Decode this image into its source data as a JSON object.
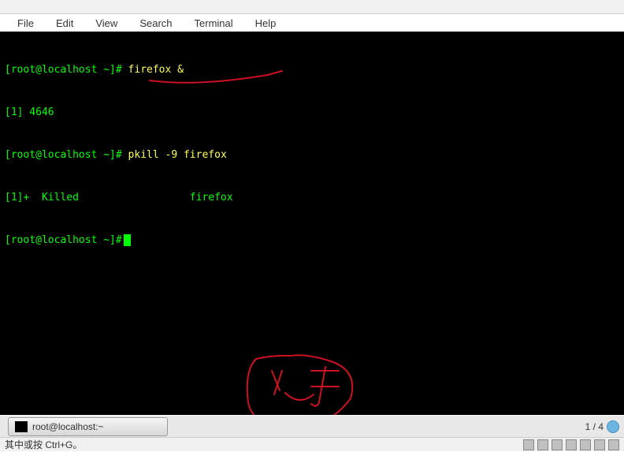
{
  "menu": {
    "file": "File",
    "edit": "Edit",
    "view": "View",
    "search": "Search",
    "terminal": "Terminal",
    "help": "Help"
  },
  "terminal": {
    "lines": [
      {
        "prompt": "[root@localhost ~]#",
        "cmd": " firefox &"
      },
      {
        "job": "[1] 4646"
      },
      {
        "prompt": "[root@localhost ~]#",
        "cmd": " pkill -9 firefox"
      },
      {
        "job": "[1]+  Killed                  firefox"
      },
      {
        "prompt": "[root@localhost ~]#",
        "cursor": true
      }
    ]
  },
  "taskbar": {
    "window_title": "root@localhost:~",
    "workspace": "1 / 4"
  },
  "status": {
    "hint": "其中或按 Ctrl+G。"
  }
}
